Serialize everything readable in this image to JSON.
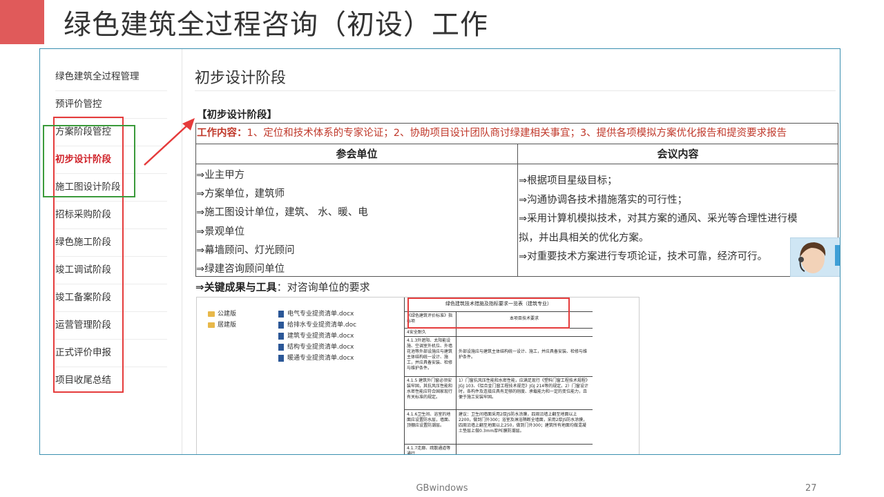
{
  "slide": {
    "title": "绿色建筑全过程咨询（初设）工作",
    "accent_color": "#e05a5a",
    "footer": "GBwindows",
    "page_number": "27"
  },
  "sidebar": {
    "items": [
      {
        "label": "绿色建筑全过程管理",
        "active": false
      },
      {
        "label": "预评价管控",
        "active": false
      },
      {
        "label": "方案阶段管控",
        "active": false
      },
      {
        "label": "初步设计阶段",
        "active": true
      },
      {
        "label": "施工图设计阶段",
        "active": false
      },
      {
        "label": "招标采购阶段",
        "active": false
      },
      {
        "label": "绿色施工阶段",
        "active": false
      },
      {
        "label": "竣工调试阶段",
        "active": false
      },
      {
        "label": "竣工备案阶段",
        "active": false
      },
      {
        "label": "运营管理阶段",
        "active": false
      },
      {
        "label": "正式评价申报",
        "active": false
      },
      {
        "label": "项目收尾总结",
        "active": false
      }
    ],
    "active_color": "#d0232a"
  },
  "main": {
    "heading": "初步设计阶段",
    "stage_label": "【初步设计阶段】",
    "work": {
      "label": "工作内容：",
      "text": "1、定位和技术体系的专家论证；2、协助项目设计团队商讨绿建相关事宜；3、提供各项模拟方案优化报告和提资要求报告"
    },
    "table": {
      "col1_header": "参会单位",
      "col2_header": "会议内容",
      "participants": [
        "⇒业主甲方",
        "⇒方案单位，建筑师",
        "⇒施工图设计单位，建筑、 水、暖、电",
        "⇒景观单位",
        "⇒幕墙顾问、灯光顾问",
        "⇒绿建咨询顾问单位"
      ],
      "meeting": [
        "⇒根据项目星级目标；",
        "⇒沟通协调各技术措施落实的可行性；",
        "⇒采用计算机模拟技术，对其方案的通风、采光等合理性进行模",
        "拟，并出具相关的优化方案。",
        "⇒对重要技术方案进行专项论证，技术可靠，经济可行。"
      ]
    },
    "key": {
      "label": "⇒关键成果与工具",
      "text": "：对咨询单位的要求"
    },
    "doc_panel": {
      "folders": [
        "公建版",
        "居建版"
      ],
      "files": [
        "电气专业提资清单.docx",
        "给排水专业提资清单.doc",
        "建筑专业提资清单.docx",
        "结构专业提资清单.docx",
        "暖通专业提资清单.docx"
      ],
      "spec_table": {
        "title": "绿色建筑技术措施及指标要求一览表（建筑专业）",
        "col1": "《绿色建筑评价标准》指标项",
        "col2": "本项目技术要求",
        "rows": [
          {
            "item": "4安全耐久",
            "req": ""
          },
          {
            "item": "4.1.3外遮阳、太阳能设施、空调室外机位、外墙花池等外部设施应与建筑主体结构统一设计、施工，并应具备安装、检修与维护条件。",
            "req": "外部设施应与建筑主体结构统一设计、施工，并应具备安装、检修与维护条件。"
          },
          {
            "item": "4.1.5 建筑外门窗必须安装牢固，其抗风压性能和水密性能应符合国家现行有关标准的规定。",
            "req": "1）门窗抗风压性能和水密性能，应满足现行《塑料门窗工程技术规程》JGJ 103、《铝合金门窗工程技术规范》JGJ 214等的规定。2）门窗设计时，各构件及连接应具有足够的刚度、承载能力和一定的变位能力，且便于施工安装牢固。"
          },
          {
            "item": "4.1.6卫生间、浴室的地面应设置防水层，墙面、顶棚应设置防潮层。",
            "req": "建议：卫生间墙面采用2厚JS防水涂膜，四周沿墙上翻至地面以上2200，做到门外300；浴室及淋浴隔断全墙面，采用2厚JS防水涂膜，四周沿墙上翻至地面以上250，做到门外300；建筑所有地面均做混凝土垫层上做0.3mm厚PE膜防潮层。"
          },
          {
            "item": "4.1.7走廊、疏散通道等通行",
            "req": ""
          }
        ]
      }
    }
  }
}
